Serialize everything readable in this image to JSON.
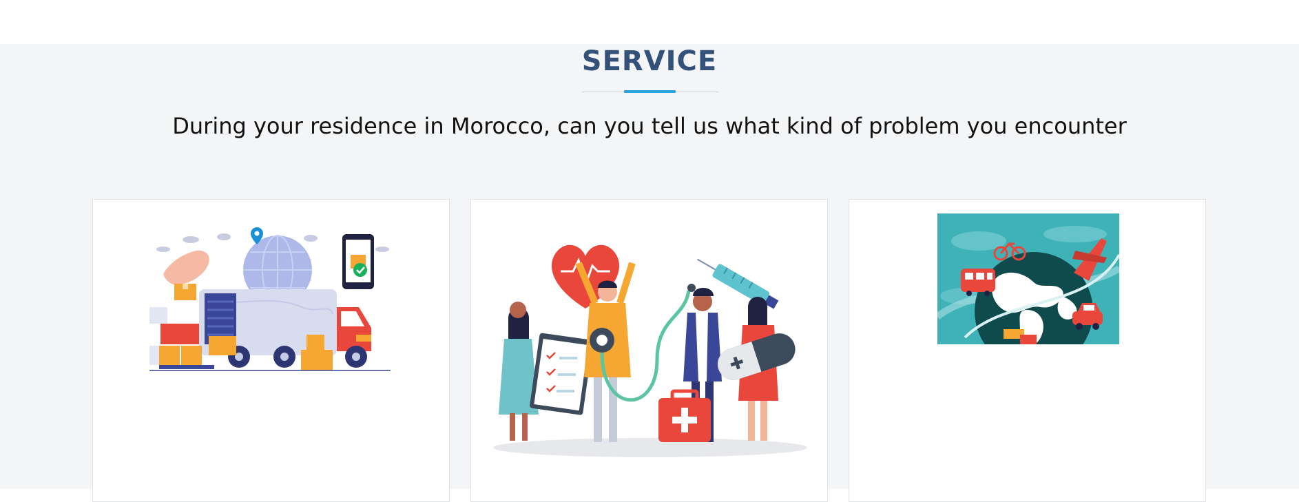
{
  "section": {
    "title": "SERVICE",
    "subtitle": "During your residence in Morocco, can you tell us what kind of problem you encounter"
  },
  "colors": {
    "title": "#34517a",
    "accent": "#2aa3dc",
    "section_bg": "#f4f5f7"
  },
  "cards": [
    {
      "illustration": "delivery-truck-illustration"
    },
    {
      "illustration": "medical-team-illustration"
    },
    {
      "illustration": "travel-globe-illustration"
    }
  ]
}
